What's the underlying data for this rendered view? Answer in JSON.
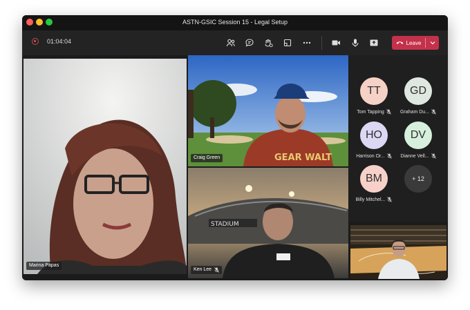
{
  "window": {
    "title": "ASTN-GSIC Session 15 - Legal Setup"
  },
  "toolbar": {
    "timer": "01:04:04",
    "leave_label": "Leave",
    "icons": [
      "people-icon",
      "chat-icon",
      "reactions-icon",
      "share-tray-icon",
      "more-icon",
      "camera-icon",
      "mic-icon",
      "share-icon"
    ]
  },
  "video_tiles": [
    {
      "name": "Marina Papas",
      "muted": false
    },
    {
      "name": "Craig Green",
      "muted": false
    },
    {
      "name": "Ken Lee",
      "muted": true
    },
    {
      "name": "",
      "muted": false
    }
  ],
  "roster": {
    "participants": [
      {
        "initials": "TT",
        "name": "Tom Tapping",
        "color": "#f6d1c6"
      },
      {
        "initials": "GD",
        "name": "Graham Du...",
        "color": "#dfe8e0"
      },
      {
        "initials": "HO",
        "name": "Harrison Or...",
        "color": "#dcd8f4"
      },
      {
        "initials": "DV",
        "name": "Dianne Vell...",
        "color": "#d6f0dd"
      },
      {
        "initials": "BM",
        "name": "Billy Mitchel...",
        "color": "#f7d1c9"
      }
    ],
    "overflow": "+ 12"
  },
  "colors": {
    "leave": "#c4314b",
    "toolbar": "#232323",
    "stage": "#1b1b1b"
  }
}
